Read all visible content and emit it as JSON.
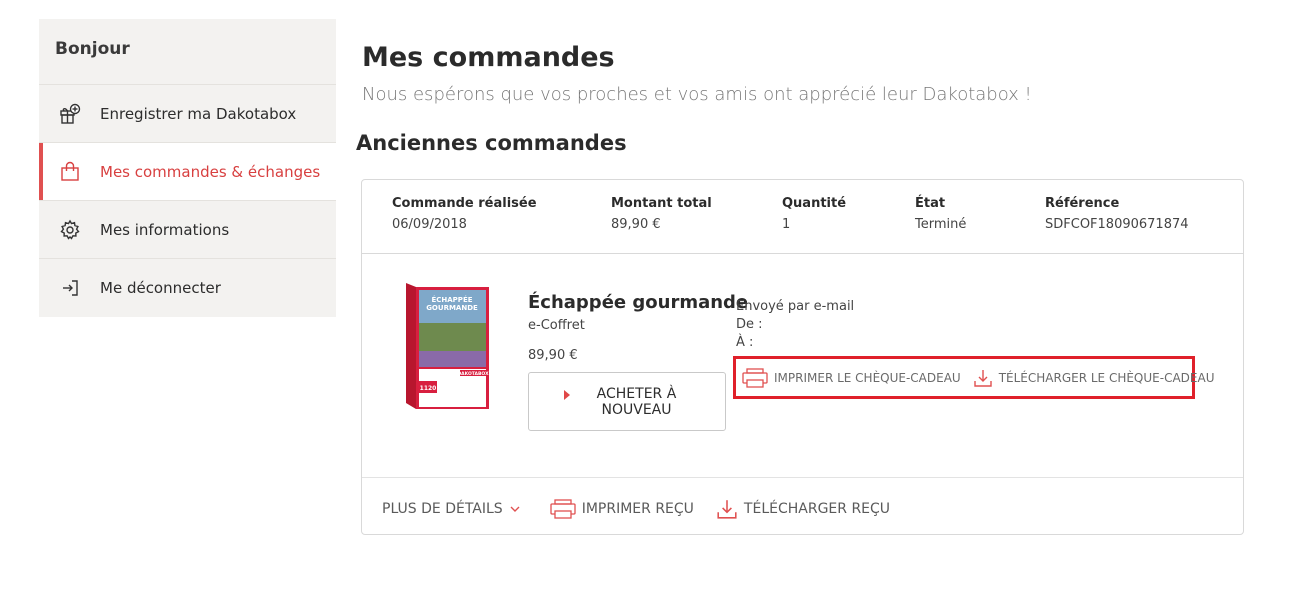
{
  "sidebar": {
    "greeting": "Bonjour",
    "items": [
      {
        "label": "Enregistrer ma Dakotabox",
        "icon": "gift-add-icon"
      },
      {
        "label": "Mes commandes & échanges",
        "icon": "shopping-bag-icon",
        "active": true
      },
      {
        "label": "Mes informations",
        "icon": "gear-icon"
      },
      {
        "label": "Me déconnecter",
        "icon": "logout-icon"
      }
    ]
  },
  "main": {
    "title": "Mes commandes",
    "subtitle": "Nous espérons que vos proches et vos amis ont apprécié leur Dakotabox !",
    "section_title": "Anciennes commandes"
  },
  "order": {
    "columns": [
      {
        "label": "Commande réalisée",
        "value": "06/09/2018"
      },
      {
        "label": "Montant total",
        "value": "89,90 €"
      },
      {
        "label": "Quantité",
        "value": "1"
      },
      {
        "label": "État",
        "value": "Terminé"
      },
      {
        "label": "Référence",
        "value": "SDFCOF18090671874"
      }
    ],
    "product": {
      "name": "Échappée gourmande",
      "type": "e-Coffret",
      "price": "89,90 €",
      "buy_again": "ACHETER À NOUVEAU",
      "box_title": "ÉCHAPPÉE GOURMANDE",
      "box_brand": "DAKOTABOX",
      "box_count": "1120"
    },
    "delivery": {
      "sent": "Envoyé par e-mail",
      "from": "De :",
      "to": "À :"
    },
    "voucher_actions": {
      "print": "IMPRIMER LE CHÈQUE-CADEAU",
      "download": "TÉLÉCHARGER LE CHÈQUE-CADEAU"
    },
    "footer": {
      "details": "PLUS DE DÉTAILS",
      "print_receipt": "IMPRIMER REÇU",
      "download_receipt": "TÉLÉCHARGER REÇU"
    }
  },
  "colors": {
    "accent": "#e05050",
    "highlight_border": "#e0202a",
    "sidebar_bg": "#f3f2f0"
  }
}
